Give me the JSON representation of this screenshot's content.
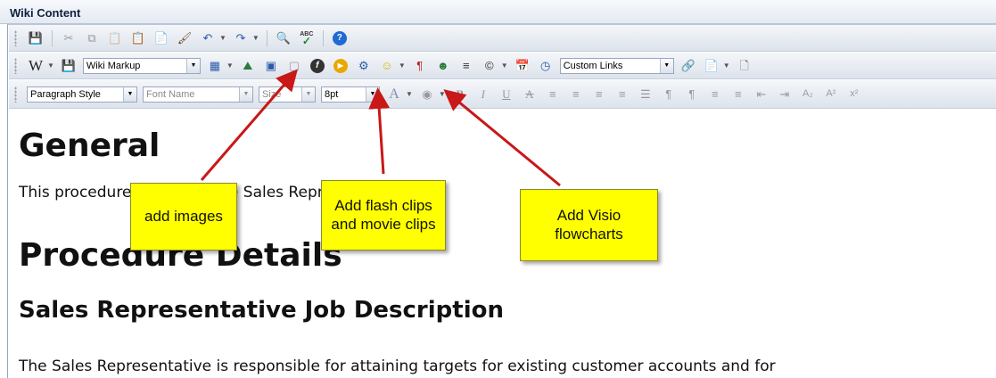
{
  "panel": {
    "title": "Wiki Content"
  },
  "toolbar1": {
    "icons": [
      "save-icon",
      "cut-icon",
      "copy-icon",
      "paste-icon",
      "paste-text-icon",
      "paste-word-icon",
      "format-painter-icon",
      "undo-icon",
      "redo-icon",
      "find-icon",
      "spellcheck-icon",
      "help-icon"
    ],
    "spell_label": "ABC"
  },
  "toolbar2": {
    "wiki_label": "W",
    "markup_select": "Wiki Markup",
    "links_select": "Custom Links"
  },
  "toolbar3": {
    "paragraph_select": "Paragraph Style",
    "font_select": "Font Name",
    "size_select": "Size",
    "size_value": "8pt",
    "font_color_glyph": "A",
    "bold_glyph": "B",
    "italic_glyph": "I",
    "underline_glyph": "U",
    "strike_glyph": "A"
  },
  "content": {
    "heading_general": "General",
    "para_intro": "This procedure describes the Sales Representative role.",
    "heading_details": "Procedure Details",
    "heading_job": "Sales Representative Job Description",
    "para_body": "The Sales Representative is responsible for attaining targets for existing customer accounts and for"
  },
  "callouts": {
    "images": "add images",
    "flash": "Add flash clips and movie clips",
    "visio": "Add Visio flowcharts"
  },
  "colors": {
    "accent": "#1f5fb4",
    "callout": "#ffff00",
    "arrow": "#c81818"
  }
}
